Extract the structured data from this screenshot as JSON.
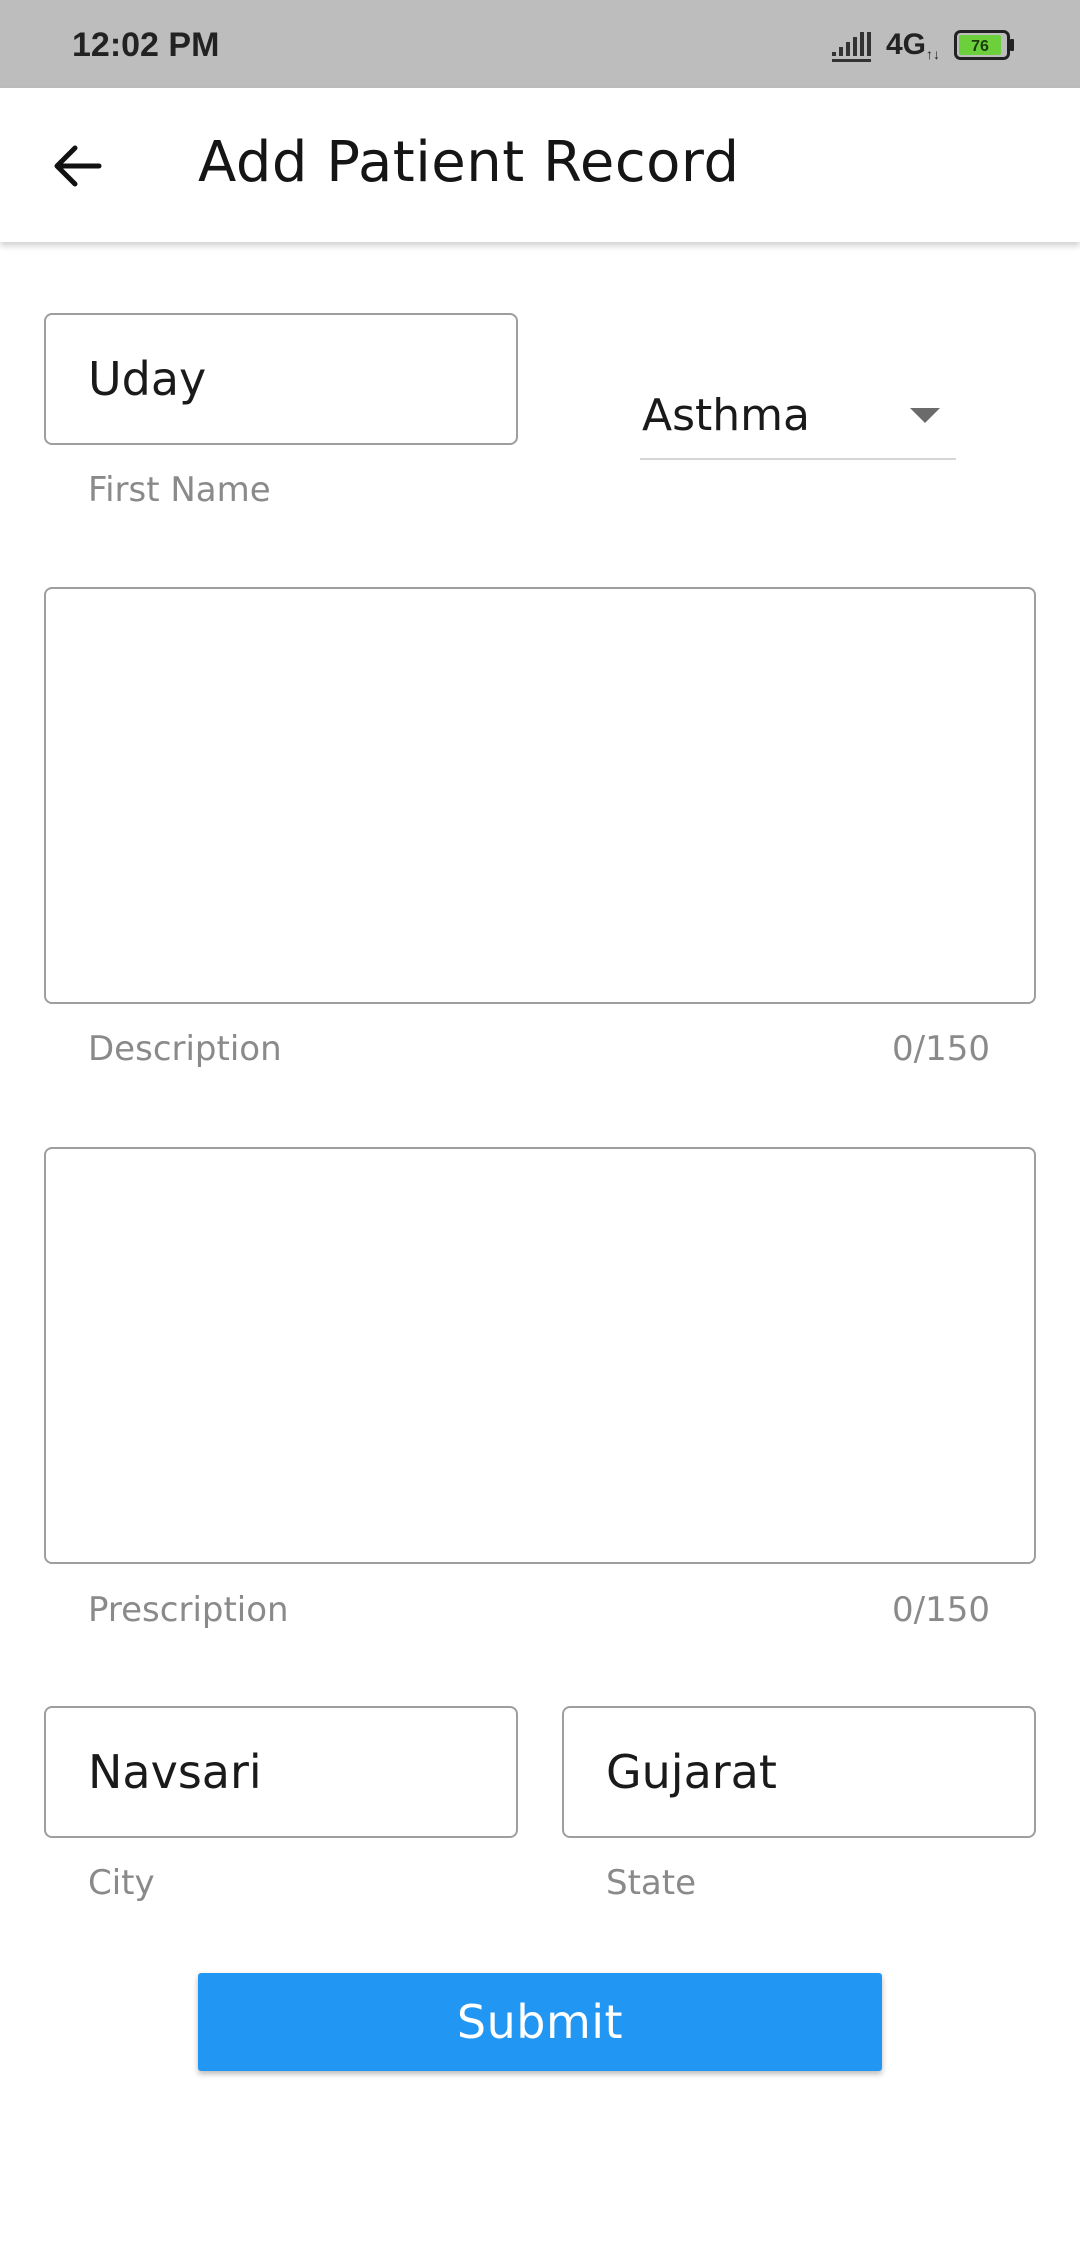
{
  "status_bar": {
    "time": "12:02 PM",
    "network": "4G",
    "battery_level": "76",
    "battery_color": "#6ccf3c"
  },
  "app_bar": {
    "back_icon": "arrow-left-icon",
    "title": "Add Patient Record"
  },
  "form": {
    "first_name": {
      "value": "Uday",
      "label": "First Name"
    },
    "disease_dropdown": {
      "selected": "Asthma",
      "icon": "dropdown-arrow-icon"
    },
    "description": {
      "value": "",
      "label": "Description",
      "counter": "0/150"
    },
    "prescription": {
      "value": "",
      "label": "Prescription",
      "counter": "0/150"
    },
    "city": {
      "value": "Navsari",
      "label": "City"
    },
    "state": {
      "value": "Gujarat",
      "label": "State"
    },
    "submit_label": "Submit",
    "submit_color": "#2196f3"
  }
}
